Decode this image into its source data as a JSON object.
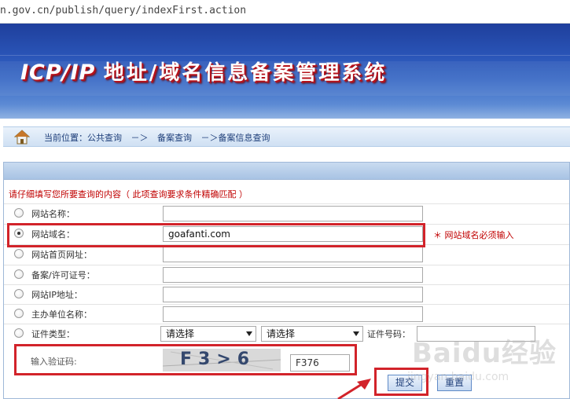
{
  "browser": {
    "url": "n.gov.cn/publish/query/indexFirst.action"
  },
  "banner": {
    "title_latin": "ICP/IP",
    "title_cn": "地址/域名信息备案管理系统"
  },
  "breadcrumb": {
    "items": [
      "当前位置：公共查询",
      "－＞",
      "备案查询",
      "－＞备案信息查询"
    ]
  },
  "form": {
    "instruction": "请仔细填写您所要查询的内容（ 此项查询要求条件精确匹配 ）",
    "fields": [
      {
        "label": "网站名称：",
        "value": "",
        "checked": false
      },
      {
        "label": "网站域名：",
        "value": "goafanti.com",
        "checked": true,
        "note": "＊ 网站域名必须输入"
      },
      {
        "label": "网站首页网址：",
        "value": "",
        "checked": false
      },
      {
        "label": "备案/许可证号：",
        "value": "",
        "checked": false
      },
      {
        "label": "网站IP地址：",
        "value": "",
        "checked": false
      },
      {
        "label": "主办单位名称：",
        "value": "",
        "checked": false
      }
    ],
    "cert": {
      "label": "证件类型：",
      "select1": "请选择",
      "select2": "请选择",
      "number_label": "证件号码：",
      "number_value": ""
    },
    "captcha": {
      "label": "输入验证码:",
      "image_text": "F3>6",
      "value": "F376"
    },
    "buttons": {
      "submit": "提交",
      "reset": "重置"
    }
  },
  "watermark": {
    "brand": "Baidu经验",
    "url": "jingyan.baidu.com"
  },
  "colors": {
    "annotation_red": "#d2232a",
    "banner_blue": "#2a55b8",
    "note_red": "#c00000"
  }
}
